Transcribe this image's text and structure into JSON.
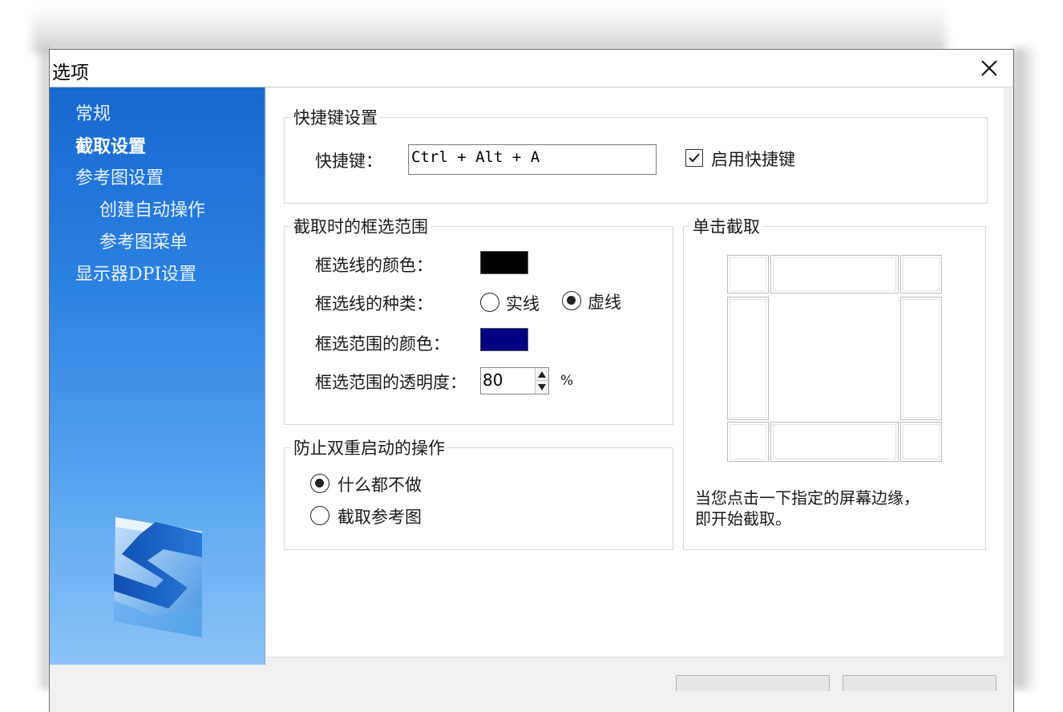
{
  "window": {
    "title": "选项"
  },
  "sidebar": {
    "items": [
      {
        "label": "常规"
      },
      {
        "label": "截取设置"
      },
      {
        "label": "参考图设置"
      },
      {
        "label": "创建自动操作"
      },
      {
        "label": "参考图菜单"
      },
      {
        "label": "显示器DPI设置"
      }
    ],
    "active_index": 1
  },
  "hotkey_group": {
    "title": "快捷键设置",
    "label": "快捷键：",
    "value": "Ctrl + Alt + A",
    "enable_label": "启用快捷键",
    "enabled": true
  },
  "selection_group": {
    "title": "截取时的框选范围",
    "line_color_label": "框选线的颜色：",
    "line_color": "#000000",
    "line_type_label": "框选线的种类：",
    "line_types": [
      {
        "label": "实线",
        "checked": false
      },
      {
        "label": "虚线",
        "checked": true
      }
    ],
    "area_color_label": "框选范围的颜色：",
    "area_color": "#000080",
    "opacity_label": "框选范围的透明度：",
    "opacity_value": "80",
    "opacity_unit": "%"
  },
  "double_start_group": {
    "title": "防止双重启动的操作",
    "options": [
      {
        "label": "什么都不做",
        "checked": true
      },
      {
        "label": "截取参考图",
        "checked": false
      }
    ]
  },
  "single_click_group": {
    "title": "单击截取",
    "description_line1": "当您点击一下指定的屏幕边缘，",
    "description_line2": "即开始截取。"
  },
  "colors": {
    "sidebar_top": "#1868cf",
    "sidebar_bottom": "#8cc3f7",
    "line_swatch": "#000000",
    "area_swatch": "#000080"
  },
  "icons": {
    "close": "close-icon",
    "checkbox": "checkmark-icon",
    "logo": "app-logo-icon",
    "spin_up": "triangle-up-icon",
    "spin_down": "triangle-down-icon"
  }
}
